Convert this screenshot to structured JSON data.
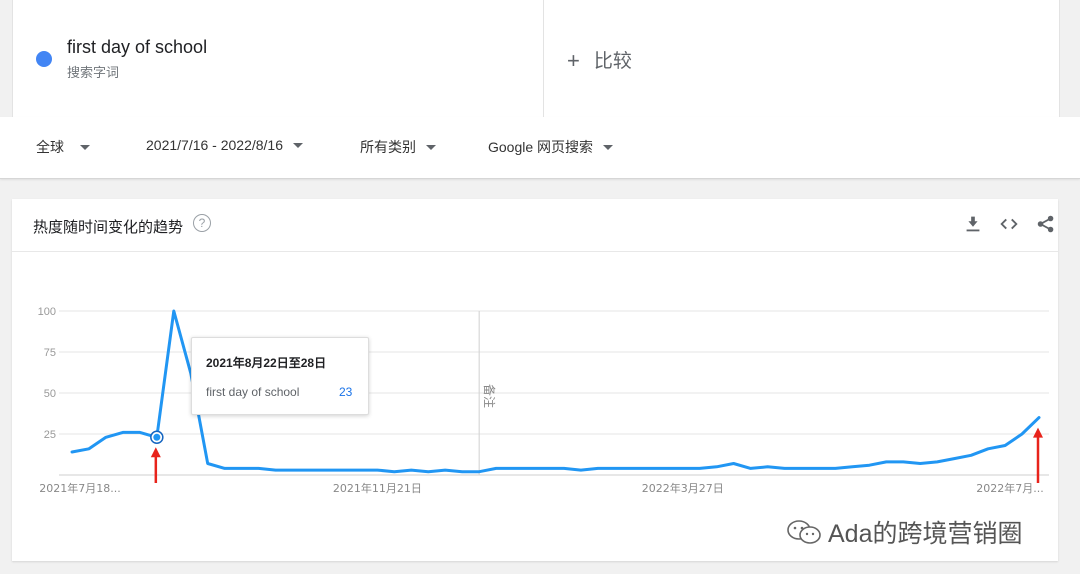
{
  "term": {
    "name": "first day of school",
    "type": "搜索字词",
    "color": "#4285f4"
  },
  "compare": {
    "plus": "+",
    "label": "比较"
  },
  "filters": {
    "region": "全球",
    "date_range": "2021/7/16 - 2022/8/16",
    "category": "所有类别",
    "search_type": "Google 网页搜索"
  },
  "card": {
    "title": "热度随时间变化的趋势",
    "help_icon": "?"
  },
  "actions": [
    "download-icon",
    "embed-icon",
    "share-icon"
  ],
  "tooltip": {
    "date": "2021年8月22日至28日",
    "term": "first day of school",
    "value": "23"
  },
  "note_label": "备注",
  "watermark": "Ada的跨境营销圈",
  "chart_data": {
    "type": "line",
    "ylim": [
      0,
      100
    ],
    "yticks": [
      25,
      50,
      75,
      100
    ],
    "xtick_labels": [
      "2021年7月18...",
      "2021年11月21日",
      "2022年3月27日",
      "2022年7月..."
    ],
    "xtick_index": [
      0,
      18,
      36,
      56
    ],
    "series": [
      {
        "name": "first day of school",
        "color": "#2196f3",
        "values": [
          14,
          16,
          23,
          26,
          26,
          23,
          100,
          62,
          7,
          4,
          4,
          4,
          3,
          3,
          3,
          3,
          3,
          3,
          3,
          2,
          3,
          2,
          3,
          2,
          2,
          4,
          4,
          4,
          4,
          4,
          3,
          4,
          4,
          4,
          4,
          4,
          4,
          4,
          5,
          7,
          4,
          5,
          4,
          4,
          4,
          4,
          5,
          6,
          8,
          8,
          7,
          8,
          10,
          12,
          16,
          18,
          25,
          35
        ]
      }
    ],
    "highlight_index": 5,
    "note_index": 24,
    "arrow_indices": [
      5,
      57
    ],
    "arrow_color": "#e8231b"
  }
}
